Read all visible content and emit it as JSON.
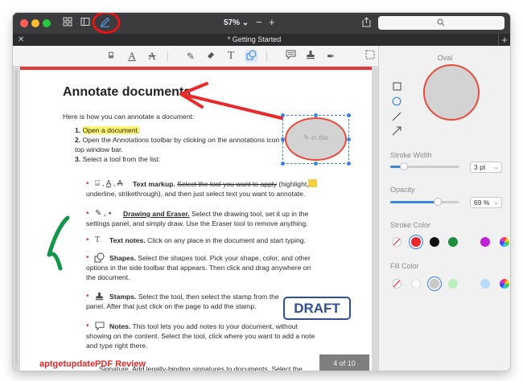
{
  "window": {
    "zoom": "57%",
    "tab_title": "* Getting Started",
    "search_placeholder": ""
  },
  "toolbar_icons": [
    "sidebar-grid-icon",
    "sidebar-panel-icon",
    "annotate-pen-icon",
    "zoom-out-icon",
    "zoom-in-icon",
    "share-icon",
    "search-icon"
  ],
  "annotation_toolbar": [
    "text-markup-icon",
    "underline-icon",
    "strikethrough-icon",
    "pencil-icon",
    "eraser-icon",
    "text-icon",
    "shapes-icon",
    "note-icon",
    "stamp-icon",
    "signature-icon",
    "selection-icon"
  ],
  "document": {
    "title": "Annotate documents",
    "intro": "Here is how you can annotate a document:",
    "steps": [
      {
        "num": "1.",
        "text": "Open a document."
      },
      {
        "num": "2.",
        "text": "Open the Annotations toolbar by clicking on the annotations icon in the"
      },
      {
        "num": "",
        "text": "top window bar."
      },
      {
        "num": "3.",
        "text": "Select a tool from the list:"
      }
    ],
    "oval_text": "in the",
    "bullets": {
      "markup_title": "Text markup.",
      "markup_strike": "Select the tool you want to apply",
      "markup_rest1": "(highlight,",
      "markup_line2": "underline, strikethrough), and then just select text you want to annotate.",
      "draw_title": "Drawing and Eraser.",
      "draw_rest1": "Select the drawing tool, set it up in the",
      "draw_line2": "settings panel, and simply draw. Use the Eraser tool to remove anything.",
      "notes_title": "Text notes.",
      "notes_rest": "Click on any place in the document and start typing.",
      "shapes_title": "Shapes.",
      "shapes_rest1": "Select the shapes tool. Pick your shape, color, and other",
      "shapes_line2": "options in the side toolbar that appears. Then click and drag anywhere on",
      "shapes_line3": "the document.",
      "stamps_title": "Stamps.",
      "stamps_rest1": "Select the tool, then select the stamp from the",
      "stamps_line2": "panel. After that just click on the page to add the stamp.",
      "notes2_title": "Notes.",
      "notes2_rest1": "This tool lets you add notes to your document, without",
      "notes2_line2": "showing on the content. Select the tool, click where you want to add a note",
      "notes2_line3": "and type right there.",
      "sig_line": "Signature. Add legally-binding signatures to documents. Select the"
    },
    "stamp_label": "DRAFT",
    "page_indicator": "4 of 10",
    "watermark": "aptgetupdatePDF Review"
  },
  "sidebar": {
    "title": "Oval",
    "stroke_width_label": "Stroke Width",
    "stroke_width_value": "3 pt",
    "stroke_width_level": 0.2,
    "opacity_label": "Opacity",
    "opacity_value": "69 %",
    "opacity_level": 0.69,
    "stroke_color_label": "Stroke Color",
    "stroke_colors": [
      "none",
      "#e8262c",
      "#111111",
      "#1e8e3e",
      "#c020d8",
      "rainbow"
    ],
    "fill_color_label": "Fill Color",
    "fill_colors": [
      "none",
      "#ffffff",
      "#c8c8c8",
      "#bdf0c0",
      "#b9d9ff",
      "rainbow"
    ]
  }
}
